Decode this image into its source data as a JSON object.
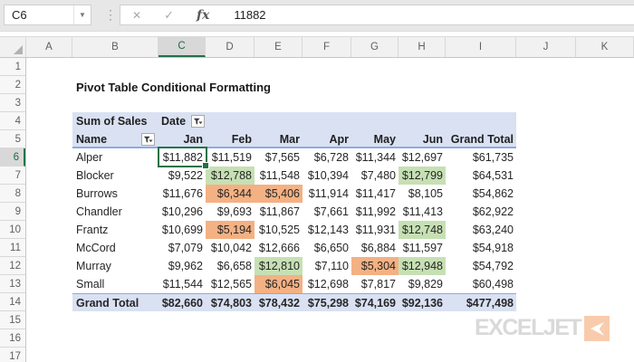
{
  "formula_bar": {
    "cell_reference": "C6",
    "value": "11882",
    "cancel_glyph": "✕",
    "confirm_glyph": "✓",
    "fx_label": "fx"
  },
  "grid": {
    "column_headers": [
      "A",
      "B",
      "C",
      "D",
      "E",
      "F",
      "G",
      "H",
      "I",
      "J",
      "K"
    ],
    "selected_column": "C",
    "row_headers": [
      "1",
      "2",
      "3",
      "4",
      "5",
      "6",
      "7",
      "8",
      "9",
      "10",
      "11",
      "12",
      "13",
      "14",
      "15",
      "16",
      "17"
    ],
    "selected_row": "6"
  },
  "sheet": {
    "title": "Pivot Table Conditional Formatting"
  },
  "pivot": {
    "field_label": "Sum of Sales",
    "column_field": "Date",
    "row_field": "Name",
    "months": [
      "Jan",
      "Feb",
      "Mar",
      "Apr",
      "May",
      "Jun"
    ],
    "grand_total_label": "Grand Total",
    "rows": [
      {
        "name": "Alper",
        "values": [
          "$11,882",
          "$11,519",
          "$7,565",
          "$6,728",
          "$11,344",
          "$12,697",
          "$61,735"
        ],
        "fills": [
          "",
          "",
          "",
          "",
          "",
          "",
          ""
        ]
      },
      {
        "name": "Blocker",
        "values": [
          "$9,522",
          "$12,788",
          "$11,548",
          "$10,394",
          "$7,480",
          "$12,799",
          "$64,531"
        ],
        "fills": [
          "",
          "g",
          "",
          "",
          "",
          "g",
          ""
        ]
      },
      {
        "name": "Burrows",
        "values": [
          "$11,676",
          "$6,344",
          "$5,406",
          "$11,914",
          "$11,417",
          "$8,105",
          "$54,862"
        ],
        "fills": [
          "",
          "o",
          "o",
          "",
          "",
          "",
          ""
        ]
      },
      {
        "name": "Chandler",
        "values": [
          "$10,296",
          "$9,693",
          "$11,867",
          "$7,661",
          "$11,992",
          "$11,413",
          "$62,922"
        ],
        "fills": [
          "",
          "",
          "",
          "",
          "",
          "",
          ""
        ]
      },
      {
        "name": "Frantz",
        "values": [
          "$10,699",
          "$5,194",
          "$10,525",
          "$12,143",
          "$11,931",
          "$12,748",
          "$63,240"
        ],
        "fills": [
          "",
          "o",
          "",
          "",
          "",
          "g",
          ""
        ]
      },
      {
        "name": "McCord",
        "values": [
          "$7,079",
          "$10,042",
          "$12,666",
          "$6,650",
          "$6,884",
          "$11,597",
          "$54,918"
        ],
        "fills": [
          "",
          "",
          "",
          "",
          "",
          "",
          ""
        ]
      },
      {
        "name": "Murray",
        "values": [
          "$9,962",
          "$6,658",
          "$12,810",
          "$7,110",
          "$5,304",
          "$12,948",
          "$54,792"
        ],
        "fills": [
          "",
          "",
          "g",
          "",
          "o",
          "g",
          ""
        ]
      },
      {
        "name": "Small",
        "values": [
          "$11,544",
          "$12,565",
          "$6,045",
          "$12,698",
          "$7,817",
          "$9,829",
          "$60,498"
        ],
        "fills": [
          "",
          "",
          "o",
          "",
          "",
          "",
          ""
        ]
      }
    ],
    "grand_total_row": {
      "name": "Grand Total",
      "values": [
        "$82,660",
        "$74,803",
        "$78,432",
        "$75,298",
        "$74,169",
        "$92,136",
        "$477,498"
      ]
    }
  },
  "colors": {
    "accent_green": "#217346",
    "highlight_green": "#c6e0b4",
    "highlight_orange": "#f4b183",
    "header_blue": "#d9e1f2",
    "border_blue": "#8faadc",
    "logo_gray": "#d9d9d9",
    "logo_orange": "#f8cbad"
  },
  "logo": {
    "text": "EXCELJET"
  }
}
